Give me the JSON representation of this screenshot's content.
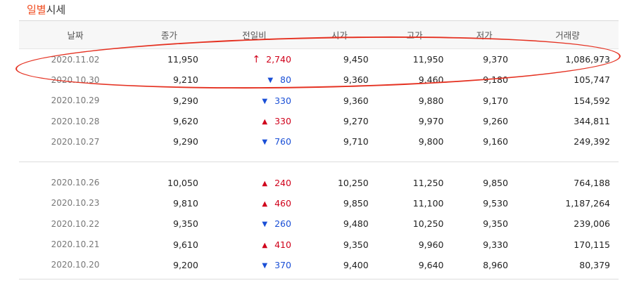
{
  "section": {
    "title_highlight": "일별",
    "title_rest": "시세"
  },
  "columns": [
    "날짜",
    "종가",
    "전일비",
    "시가",
    "고가",
    "저가",
    "거래량"
  ],
  "colors": {
    "up": "#d0021b",
    "down": "#1a4fd6",
    "title_accent": "#f04b1e",
    "annotation": "#e53222"
  },
  "rows": [
    {
      "date": "2020.11.02",
      "close": "11,950",
      "dir": "up-arrow-icon",
      "change": "2,740",
      "open": "9,450",
      "high": "11,950",
      "low": "9,370",
      "volume": "1,086,973"
    },
    {
      "date": "2020.10.30",
      "close": "9,210",
      "dir": "down-triangle-icon",
      "change": "80",
      "open": "9,360",
      "high": "9,460",
      "low": "9,180",
      "volume": "105,747"
    },
    {
      "date": "2020.10.29",
      "close": "9,290",
      "dir": "down-triangle-icon",
      "change": "330",
      "open": "9,360",
      "high": "9,880",
      "low": "9,170",
      "volume": "154,592"
    },
    {
      "date": "2020.10.28",
      "close": "9,620",
      "dir": "up-triangle-icon",
      "change": "330",
      "open": "9,270",
      "high": "9,970",
      "low": "9,260",
      "volume": "344,811"
    },
    {
      "date": "2020.10.27",
      "close": "9,290",
      "dir": "down-triangle-icon",
      "change": "760",
      "open": "9,710",
      "high": "9,800",
      "low": "9,160",
      "volume": "249,392"
    },
    {
      "date": "2020.10.26",
      "close": "10,050",
      "dir": "up-triangle-icon",
      "change": "240",
      "open": "10,250",
      "high": "11,250",
      "low": "9,850",
      "volume": "764,188"
    },
    {
      "date": "2020.10.23",
      "close": "9,810",
      "dir": "up-triangle-icon",
      "change": "460",
      "open": "9,850",
      "high": "11,100",
      "low": "9,530",
      "volume": "1,187,264"
    },
    {
      "date": "2020.10.22",
      "close": "9,350",
      "dir": "down-triangle-icon",
      "change": "260",
      "open": "9,480",
      "high": "10,250",
      "low": "9,350",
      "volume": "239,006"
    },
    {
      "date": "2020.10.21",
      "close": "9,610",
      "dir": "up-triangle-icon",
      "change": "410",
      "open": "9,350",
      "high": "9,960",
      "low": "9,330",
      "volume": "170,115"
    },
    {
      "date": "2020.10.20",
      "close": "9,200",
      "dir": "down-triangle-icon",
      "change": "370",
      "open": "9,400",
      "high": "9,640",
      "low": "8,960",
      "volume": "80,379"
    }
  ]
}
